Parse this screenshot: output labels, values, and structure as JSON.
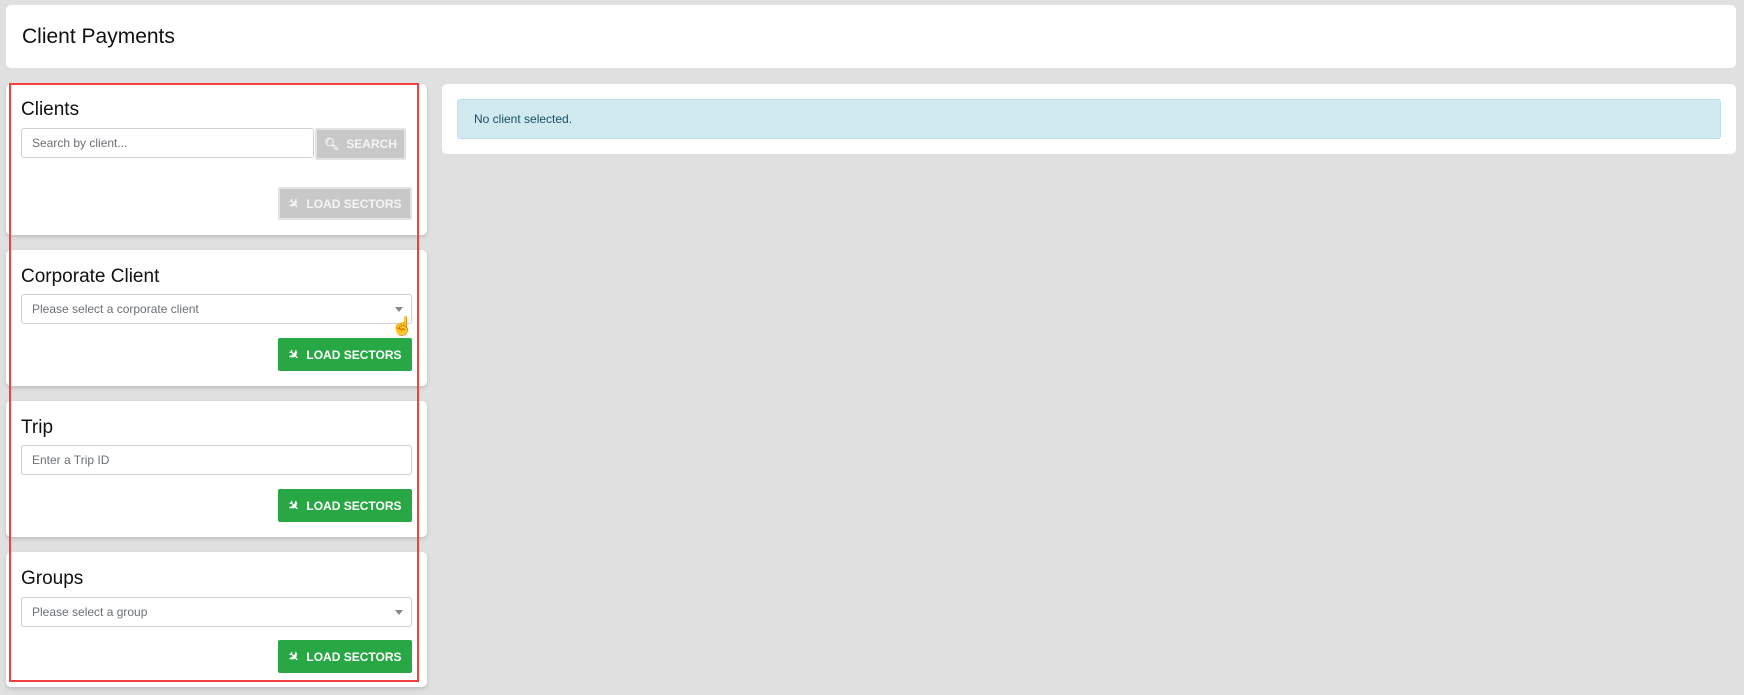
{
  "header": {
    "title": "Client Payments"
  },
  "clients": {
    "title": "Clients",
    "search_placeholder": "Search by client...",
    "search_label": "SEARCH",
    "load_label": "LOAD SECTORS"
  },
  "corporate": {
    "title": "Corporate Client",
    "select_value": "Please select a corporate client",
    "load_label": "LOAD SECTORS"
  },
  "trip": {
    "title": "Trip",
    "input_placeholder": "Enter a Trip ID",
    "load_label": "LOAD SECTORS"
  },
  "groups": {
    "title": "Groups",
    "select_value": "Please select a group",
    "load_label": "LOAD SECTORS"
  },
  "main": {
    "alert": "No client selected."
  },
  "colors": {
    "success": "#28a745",
    "info_bg": "#d1eaf0",
    "highlight": "#f04040"
  }
}
